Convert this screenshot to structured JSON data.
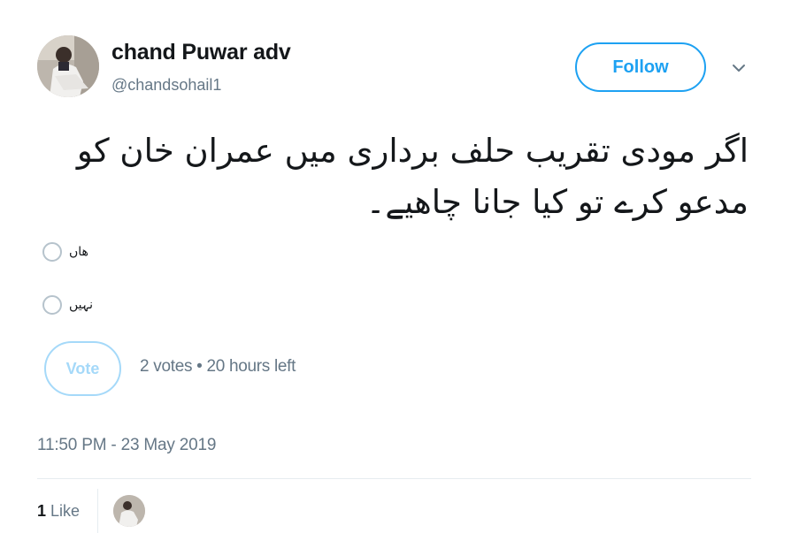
{
  "author": {
    "display_name": "chand Puwar adv",
    "handle": "@chandsohail1"
  },
  "follow_button": {
    "label": "Follow"
  },
  "menu": {
    "icon": "chevron-down-icon"
  },
  "tweet": {
    "text_line1": "اگر مودی تقریب حلف برداری میں عمران خان کو",
    "text_line2": "مدعو کرے تو کیا جانا چاھیے۔"
  },
  "poll": {
    "options": [
      {
        "label": "ھاں"
      },
      {
        "label": "نہیں"
      }
    ],
    "vote_label": "Vote",
    "meta": "2 votes • 20 hours left"
  },
  "timestamp": "11:50 PM - 23 May 2019",
  "likes": {
    "count": "1",
    "label": "Like"
  },
  "colors": {
    "accent": "#1da1f2",
    "accent_disabled": "#a5d9f9",
    "muted_text": "#657786",
    "divider": "#e6ecf0"
  }
}
